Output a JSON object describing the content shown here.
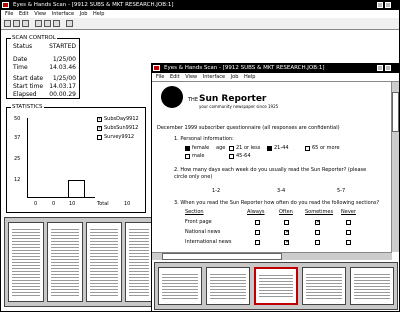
{
  "colors": {
    "accent": "#c00000",
    "titlebar": "#000000",
    "desktop": "#ffffff"
  },
  "back_window": {
    "title": "Eyes & Hands Scan - [9912 SUBS & MKT RESEARCH.JOB:1]",
    "menu": [
      "File",
      "Edit",
      "View",
      "Interface",
      "Job",
      "Help"
    ],
    "scan_control": {
      "group_title": "SCAN CONTROL",
      "status_label": "Status",
      "status_value": "STARTED",
      "date_label": "Date",
      "date_value": "1/25/00",
      "time_label": "Time",
      "time_value": "14.03.46",
      "start_date_label": "Start date",
      "start_date_value": "1/25/00",
      "start_time_label": "Start time",
      "start_time_value": "14.03.17",
      "elapsed_label": "Elapsed",
      "elapsed_value": "00.00.29"
    },
    "statistics": {
      "group_title": "STATISTICS",
      "y_ticks": [
        "50",
        "37",
        "25",
        "12"
      ],
      "x_ticks": [
        "0",
        "0",
        "10",
        "Total",
        "10"
      ],
      "legend": [
        "SubsDay9912",
        "SubsSun9912",
        "Survey9912"
      ]
    }
  },
  "front_window": {
    "title": "Eyes & Hands Scan - [9912 SUBS & MKT RESEARCH.JOB:1]",
    "menu": [
      "File",
      "Edit",
      "View",
      "Interface",
      "Job",
      "Help"
    ],
    "form": {
      "masthead_the": "THE",
      "masthead": "Sun Reporter",
      "tagline": "your community newspaper since 1925",
      "intro": "December 1999 subscriber questionnaire (all responses are confidential)",
      "q1": "1.  Personal information:",
      "q1_opts": [
        "female",
        "male",
        "age",
        "21 or less",
        "21-44",
        "45-64",
        "65 or more"
      ],
      "q2": "2.  How many days each week do you usually read the Sun Reporter? (please circle only one)",
      "q2_opts": [
        "1-2",
        "3-4",
        "5-7"
      ],
      "q3": "3.  When you read the Sun Reporter how often do you read the following sections?",
      "q3_headers": [
        "Section",
        "Always",
        "Often",
        "Sometimes",
        "Never"
      ],
      "q3_rows": [
        "Front page",
        "National news",
        "International news"
      ]
    }
  }
}
